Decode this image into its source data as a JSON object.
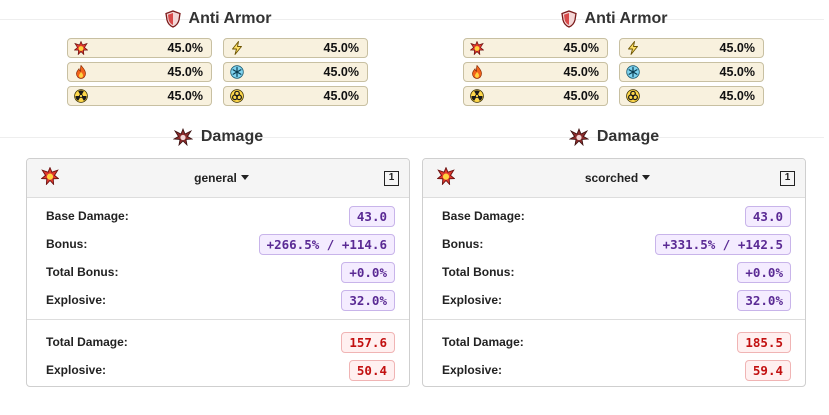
{
  "panels": [
    {
      "armor_title": "Anti Armor",
      "armor": [
        {
          "icon": "explosion-icon",
          "value": "45.0%"
        },
        {
          "icon": "lightning-icon",
          "value": "45.0%"
        },
        {
          "icon": "fire-icon",
          "value": "45.0%"
        },
        {
          "icon": "frost-icon",
          "value": "45.0%"
        },
        {
          "icon": "radiation-icon",
          "value": "45.0%"
        },
        {
          "icon": "biohazard-icon",
          "value": "45.0%"
        }
      ],
      "damage_title": "Damage",
      "dropdown": "general",
      "count": "1",
      "rows": [
        {
          "label": "Base Damage:",
          "value": "43.0"
        },
        {
          "label": "Bonus:",
          "value": "+266.5% / +114.6"
        },
        {
          "label": "Total Bonus:",
          "value": "+0.0%"
        },
        {
          "label": "Explosive:",
          "value": "32.0%"
        }
      ],
      "totals": [
        {
          "label": "Total Damage:",
          "value": "157.6"
        },
        {
          "label": "Explosive:",
          "value": "50.4"
        }
      ]
    },
    {
      "armor_title": "Anti Armor",
      "armor": [
        {
          "icon": "explosion-icon",
          "value": "45.0%"
        },
        {
          "icon": "lightning-icon",
          "value": "45.0%"
        },
        {
          "icon": "fire-icon",
          "value": "45.0%"
        },
        {
          "icon": "frost-icon",
          "value": "45.0%"
        },
        {
          "icon": "radiation-icon",
          "value": "45.0%"
        },
        {
          "icon": "biohazard-icon",
          "value": "45.0%"
        }
      ],
      "damage_title": "Damage",
      "dropdown": "scorched",
      "count": "1",
      "rows": [
        {
          "label": "Base Damage:",
          "value": "43.0"
        },
        {
          "label": "Bonus:",
          "value": "+331.5% / +142.5"
        },
        {
          "label": "Total Bonus:",
          "value": "+0.0%"
        },
        {
          "label": "Explosive:",
          "value": "32.0%"
        }
      ],
      "totals": [
        {
          "label": "Total Damage:",
          "value": "185.5"
        },
        {
          "label": "Explosive:",
          "value": "59.4"
        }
      ]
    }
  ]
}
